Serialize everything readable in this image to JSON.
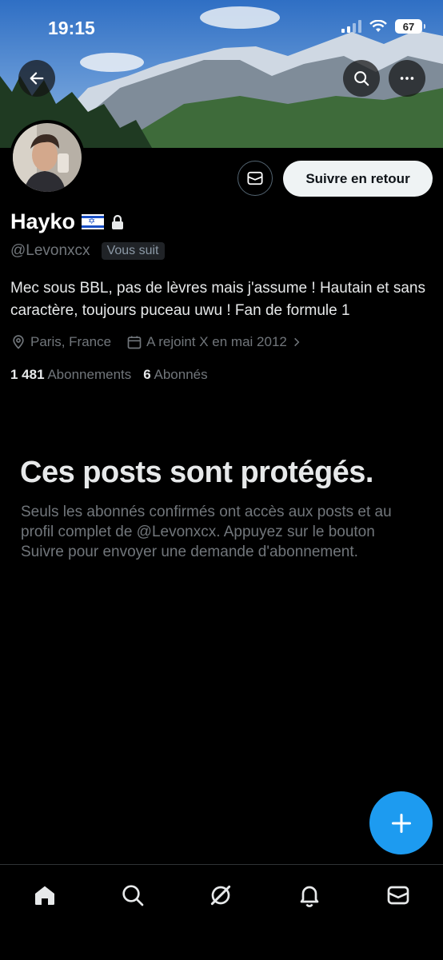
{
  "status_bar": {
    "time": "19:15",
    "battery": "67"
  },
  "profile": {
    "name": "Hayko",
    "handle": "@Levonxcx",
    "follows_you_badge": "Vous suit",
    "bio": "Mec sous BBL, pas de lèvres mais j'assume ! Hautain et sans caractère, toujours puceau uwu ! Fan de formule 1",
    "location": "Paris, France",
    "joined": "A rejoint X en mai 2012",
    "following_count": "1 481",
    "following_label": "Abonnements",
    "followers_count": "6",
    "followers_label": "Abonnés"
  },
  "actions": {
    "follow_back_label": "Suivre en retour"
  },
  "protected": {
    "title": "Ces posts sont protégés.",
    "description": "Seuls les abonnés confirmés ont accès aux posts et au profil complet de @Levonxcx. Appuyez sur le bouton Suivre pour envoyer une demande d'abonnement."
  },
  "icons": {
    "back": "arrow-left-icon",
    "search": "search-icon",
    "more": "more-horizontal-icon",
    "message": "envelope-icon",
    "lock": "lock-icon",
    "flag": "israel-flag-icon",
    "location": "location-pin-icon",
    "calendar": "calendar-icon",
    "compose": "plus-icon",
    "nav": [
      "home-icon",
      "search-icon",
      "grok-icon",
      "bell-icon",
      "envelope-icon"
    ]
  },
  "colors": {
    "accent": "#1d9bf0",
    "background": "#000000",
    "muted": "#71767b"
  }
}
